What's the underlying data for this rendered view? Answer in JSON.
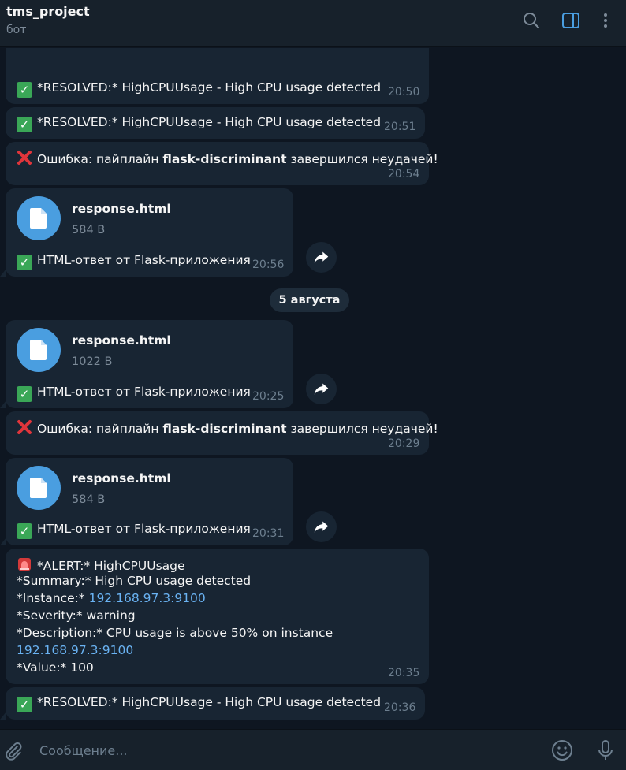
{
  "header": {
    "title": "tms_project",
    "subtitle": "бот"
  },
  "messages": {
    "m1": {
      "text": "*RESOLVED:* HighCPUUsage - High CPU usage detected",
      "time": "20:50"
    },
    "m2": {
      "text": "*RESOLVED:* HighCPUUsage - High CPU usage detected",
      "time": "20:51"
    },
    "m3": {
      "pre": "Ошибка: пайплайн ",
      "bold": "flask-discriminant",
      "post": " завершился неудачей!",
      "time": "20:54"
    },
    "m4": {
      "file_name": "response.html",
      "file_size": "584 B",
      "caption": "HTML-ответ от Flask-приложения",
      "time": "20:56"
    },
    "m5": {
      "file_name": "response.html",
      "file_size": "1022 B",
      "caption": "HTML-ответ от Flask-приложения",
      "time": "20:25"
    },
    "m6": {
      "pre": "Ошибка: пайплайн ",
      "bold": "flask-discriminant",
      "post": " завершился неудачей!",
      "time": "20:29"
    },
    "m7": {
      "file_name": "response.html",
      "file_size": "584 B",
      "caption": "HTML-ответ от Flask-приложения",
      "time": "20:31"
    },
    "m8": {
      "line1": "*ALERT:* HighCPUUsage",
      "line2": "*Summary:* High CPU usage detected",
      "line3_label": "*Instance:* ",
      "line3_link": "192.168.97.3:9100",
      "line4": "*Severity:* warning",
      "line5": "*Description:* CPU usage is above 50% on instance",
      "line6_link": "192.168.97.3:9100",
      "line7": "*Value:* 100",
      "time": "20:35"
    },
    "m9": {
      "text": "*RESOLVED:* HighCPUUsage - High CPU usage detected",
      "time": "20:36"
    }
  },
  "date_separator": "5 августа",
  "composer": {
    "placeholder": "Сообщение..."
  },
  "icons": {
    "search": "search-icon",
    "sidebar": "sidebar-toggle-icon",
    "more": "more-vertical-icon",
    "attach": "paperclip-icon",
    "emoji": "emoji-icon",
    "mic": "microphone-icon",
    "file": "file-icon",
    "share": "share-icon",
    "check": "check-mark-emoji",
    "cross": "cross-mark-emoji",
    "siren": "siren-emoji"
  },
  "colors": {
    "background": "#0e1621",
    "bubble": "#182533",
    "header": "#17212b",
    "accent": "#4a9ee0",
    "link": "#6ab3f3"
  }
}
